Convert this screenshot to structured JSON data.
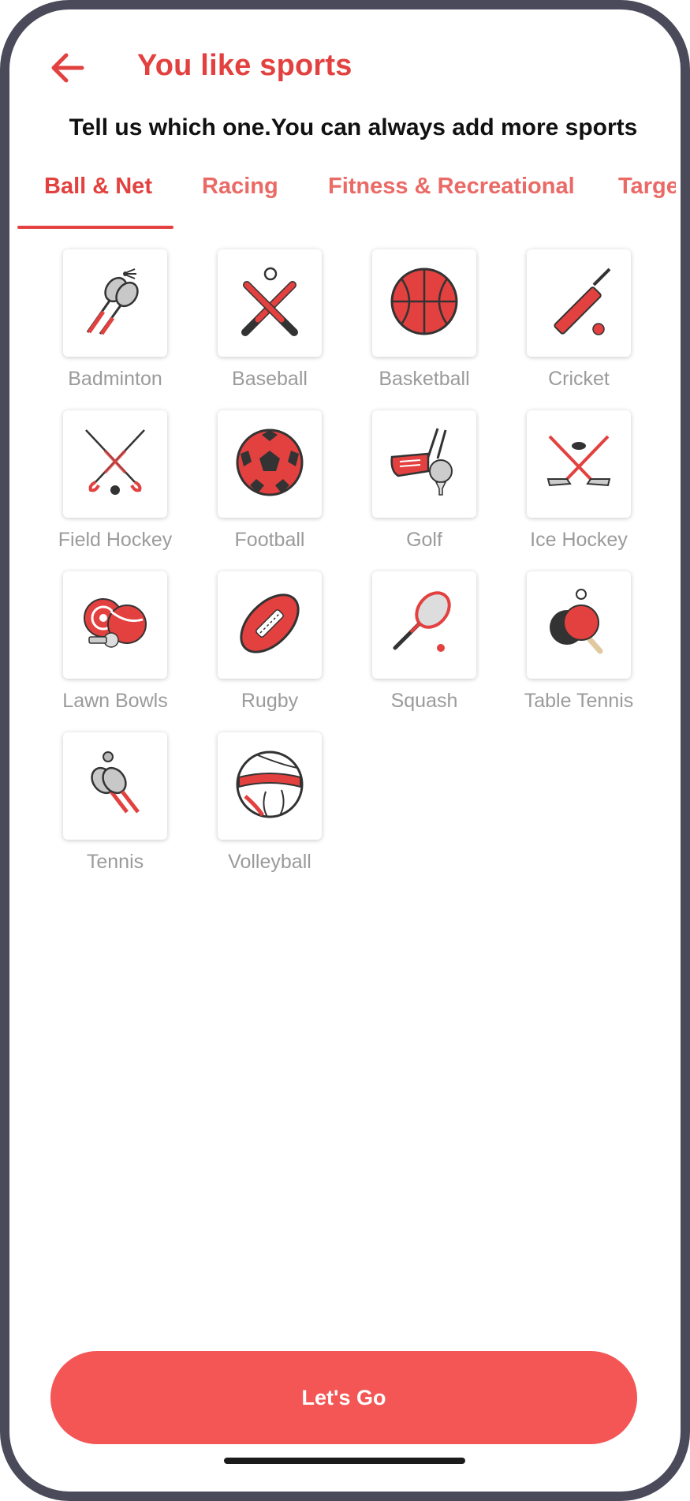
{
  "header": {
    "title": "You like sports",
    "subtitle": "Tell us which one.You can always add more sports"
  },
  "tabs": [
    {
      "label": "Ball & Net"
    },
    {
      "label": "Racing"
    },
    {
      "label": "Fitness & Recreational"
    },
    {
      "label": "Targe"
    }
  ],
  "sports": [
    {
      "label": "Badminton",
      "icon": "badminton-icon"
    },
    {
      "label": "Baseball",
      "icon": "baseball-icon"
    },
    {
      "label": "Basketball",
      "icon": "basketball-icon"
    },
    {
      "label": "Cricket",
      "icon": "cricket-icon"
    },
    {
      "label": "Field Hockey",
      "icon": "field-hockey-icon"
    },
    {
      "label": "Football",
      "icon": "football-icon"
    },
    {
      "label": "Golf",
      "icon": "golf-icon"
    },
    {
      "label": "Ice Hockey",
      "icon": "ice-hockey-icon"
    },
    {
      "label": "Lawn Bowls",
      "icon": "lawn-bowls-icon"
    },
    {
      "label": "Rugby",
      "icon": "rugby-icon"
    },
    {
      "label": "Squash",
      "icon": "squash-icon"
    },
    {
      "label": "Table Tennis",
      "icon": "table-tennis-icon"
    },
    {
      "label": "Tennis",
      "icon": "tennis-icon"
    },
    {
      "label": "Volleyball",
      "icon": "volleyball-icon"
    }
  ],
  "footer": {
    "cta_label": "Let's Go"
  },
  "colors": {
    "accent": "#e2413f",
    "button": "#f45555",
    "tab_inactive": "#ea6a66",
    "label_gray": "#9b9b9b"
  }
}
